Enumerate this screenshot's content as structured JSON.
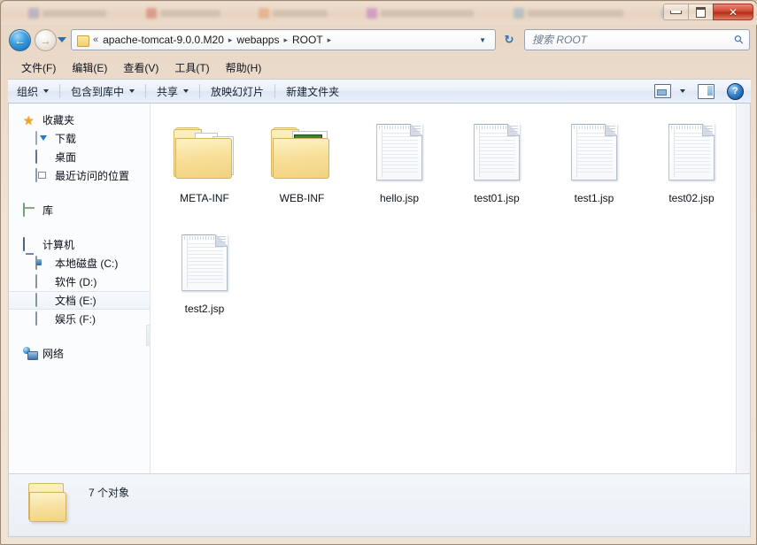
{
  "window": {
    "controls": {
      "minimize": "–",
      "maximize": "□",
      "close": "✕"
    }
  },
  "nav": {
    "back_icon": "←",
    "forward_icon": "→",
    "history_dropdown_icon": "chevron-down-icon",
    "refresh_icon": "↻",
    "breadcrumb": {
      "overflow": "«",
      "items": [
        "apache-tomcat-9.0.0.M20",
        "webapps",
        "ROOT"
      ],
      "separator": "▸",
      "trailing_separator": "▸",
      "dropdown_icon": "▼"
    },
    "search": {
      "placeholder": "搜索 ROOT",
      "value": "",
      "icon": "search-icon"
    }
  },
  "menubar": {
    "items": [
      {
        "label": "文件(F)"
      },
      {
        "label": "编辑(E)"
      },
      {
        "label": "查看(V)"
      },
      {
        "label": "工具(T)"
      },
      {
        "label": "帮助(H)"
      }
    ]
  },
  "toolbar": {
    "items": [
      {
        "label": "组织",
        "caret": true
      },
      {
        "label": "包含到库中",
        "caret": true
      },
      {
        "label": "共享",
        "caret": true
      },
      {
        "label": "放映幻灯片",
        "caret": false
      },
      {
        "label": "新建文件夹",
        "caret": false
      }
    ],
    "right": {
      "view_icon": "view-mode-icon",
      "view_caret": "▼",
      "preview_icon": "preview-pane-icon",
      "help_icon": "?"
    }
  },
  "navpane": {
    "groups": [
      {
        "header": {
          "label": "收藏夹",
          "icon": "star-icon"
        },
        "children": [
          {
            "label": "下载",
            "icon": "downloads-icon"
          },
          {
            "label": "桌面",
            "icon": "desktop-icon"
          },
          {
            "label": "最近访问的位置",
            "icon": "recent-places-icon"
          }
        ]
      },
      {
        "header": {
          "label": "库",
          "icon": "library-icon"
        },
        "children": []
      },
      {
        "header": {
          "label": "计算机",
          "icon": "computer-icon"
        },
        "children": [
          {
            "label": "本地磁盘 (C:)",
            "icon": "system-drive-icon",
            "selected": false
          },
          {
            "label": "软件 (D:)",
            "icon": "drive-icon",
            "selected": false
          },
          {
            "label": "文档 (E:)",
            "icon": "drive-icon",
            "selected": true
          },
          {
            "label": "娱乐 (F:)",
            "icon": "drive-icon",
            "selected": false
          }
        ]
      },
      {
        "header": {
          "label": "网络",
          "icon": "network-icon"
        },
        "children": []
      }
    ]
  },
  "files": [
    {
      "name": "META-INF",
      "type": "folder",
      "badge": ""
    },
    {
      "name": "WEB-INF",
      "type": "folder-xml",
      "badge": "XML"
    },
    {
      "name": "hello.jsp",
      "type": "file"
    },
    {
      "name": "test01.jsp",
      "type": "file"
    },
    {
      "name": "test1.jsp",
      "type": "file"
    },
    {
      "name": "test02.jsp",
      "type": "file"
    },
    {
      "name": "test2.jsp",
      "type": "file"
    }
  ],
  "statusbar": {
    "text": "7 个对象",
    "icon": "folder-icon"
  },
  "colors": {
    "frame": "#e8d6c4",
    "close_button": "#c13a1f",
    "accent_blue": "#2d6fb0",
    "folder_yellow": "#f5dd94",
    "selection": "#eef4fa"
  }
}
